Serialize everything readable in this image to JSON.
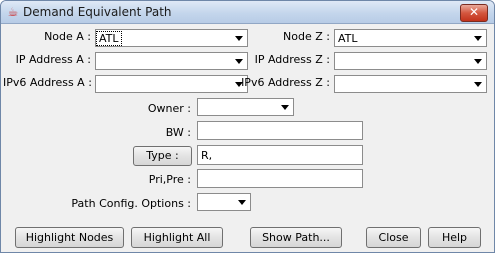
{
  "window": {
    "title": "Demand Equivalent Path"
  },
  "fields": {
    "node_a_label": "Node A :",
    "node_a_value": "ATL",
    "node_z_label": "Node Z :",
    "node_z_value": "ATL",
    "ip_a_label": "IP Address A :",
    "ip_a_value": "",
    "ip_z_label": "IP Address Z :",
    "ip_z_value": "",
    "ipv6_a_label": "IPv6 Address A :",
    "ipv6_a_value": "",
    "ipv6_z_label": "IPv6 Address Z :",
    "ipv6_z_value": "",
    "owner_label": "Owner :",
    "owner_value": "",
    "bw_label": "BW :",
    "bw_value": "",
    "type_button": "Type :",
    "type_value": "R,",
    "pri_pre_label": "Pri,Pre :",
    "pri_pre_value": "",
    "path_config_label": "Path Config. Options :",
    "path_config_value": ""
  },
  "buttons": {
    "highlight_nodes": "Highlight Nodes",
    "highlight_all": "Highlight All",
    "show_path": "Show Path...",
    "close": "Close",
    "help": "Help"
  }
}
